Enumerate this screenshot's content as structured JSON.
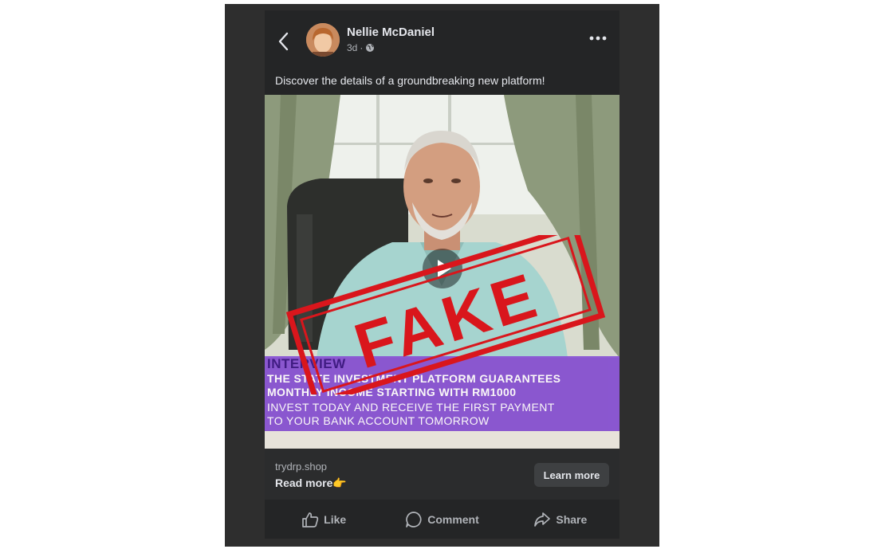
{
  "post": {
    "author": "Nellie McDaniel",
    "time": "3d",
    "separator": "·",
    "caption": "Discover the details of a groundbreaking new platform!"
  },
  "video": {
    "stamp": "FAKE",
    "banner": {
      "line1": "INTERVIEW",
      "line2": "THE STATE INVESTMENT PLATFORM GUARANTEES",
      "line3": "MONTHLY INCOME STARTING WITH RM1000",
      "line4": "INVEST TODAY AND RECEIVE THE FIRST PAYMENT",
      "line5": "TO YOUR BANK ACCOUNT TOMORROW"
    }
  },
  "link": {
    "domain": "trydrp.shop",
    "read_more": "Read more👉",
    "cta": "Learn more"
  },
  "actions": {
    "like": "Like",
    "comment": "Comment",
    "share": "Share"
  },
  "icons": [
    "back-arrow-icon",
    "globe-icon",
    "more-options-icon",
    "play-icon",
    "like-icon",
    "comment-icon",
    "share-icon"
  ],
  "colors": {
    "card_bg": "#242526",
    "stamp_red": "#d9161c",
    "banner_purple": "#8a57d6"
  }
}
